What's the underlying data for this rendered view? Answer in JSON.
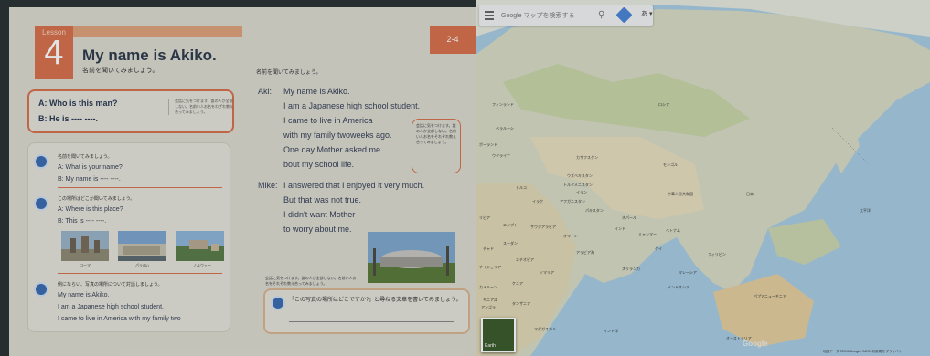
{
  "book": {
    "lesson_label": "Lesson",
    "lesson_number": "4",
    "title": "My name is Akiko.",
    "subtitle": "名前を聞いてみましょう。",
    "page_tab": "2-4",
    "qa": {
      "line1": "A: Who is this man?",
      "line2": "B: He is ---- ----.",
      "note": "会話に気をつけます。誰の人か全部しない。名前い人お名をわざれ教え合ってみましょう。"
    },
    "exercises": [
      {
        "title": "名前を聞いてみましょう。",
        "lines": [
          "A: What is your name?",
          "B: My name is ---- ----."
        ]
      },
      {
        "title": "この場所はどこか聞いてみましょう。",
        "lines": [
          "A: Where is this place?",
          "B: This is ---- ----."
        ],
        "captions": [
          "ローマ",
          "パリ(仏)",
          "ノルウェー"
        ]
      },
      {
        "title": "例にならい、写真の場所について対話しましょう。",
        "lines": [
          "My name is Akiko.",
          "I am a Japanese high school student.",
          "I came to live in America with my family two"
        ]
      }
    ],
    "page2_heading": "名前を聞いてみましょう。",
    "dialogue": [
      {
        "speaker": "Aki:",
        "lines": [
          "My name is Akiko.",
          "I am a Japanese high school student.",
          "I came to live in America",
          "with my family twoweeks ago.",
          "One day Mother asked me",
          "bout my school life."
        ]
      },
      {
        "speaker": "Mike:",
        "lines": [
          "I answered that I enjoyed it very much.",
          "But that was not true.",
          "I didn't want Mother",
          "to worry about me."
        ]
      }
    ],
    "side_note": "会話に気をつけます。誰の人か全部しない。名前い人お名をそれぞれ教え合ってみましょう。",
    "bottom_note": "会話に気をつけます。誰の人か全部しない。名前い人お名をそれぞれ教え合ってみましょう。",
    "write_prompt": "「この写真の場所はどこですか?」と尋ねる文章を書いてみましょう。"
  },
  "map": {
    "search_placeholder": "Google マップを検索する",
    "lang": "あ ▾",
    "earth_label": "Earth",
    "logo": "Google",
    "attribution": "地図データ ©2016 Google, INEGI   利用規約   プライバシー",
    "labels": [
      "ロシア",
      "フィンランド",
      "ポーランド",
      "ウクライナ",
      "カザフスタン",
      "モンゴル",
      "トルコ",
      "イラン",
      "中華人民共和国",
      "日本",
      "インド",
      "エジプト",
      "リビア",
      "サウジアラビア",
      "スーダン",
      "エチオピア",
      "ケニア",
      "タンザニア",
      "アンゴラ",
      "マダガスカル",
      "インドネシア",
      "パプアニューギニア",
      "オーストラリア",
      "フィリピン",
      "タイ",
      "ミャンマー",
      "アフガニスタン",
      "パキスタン",
      "イラク",
      "ソマリア",
      "マレーシア",
      "南アフリカ",
      "ウズベキスタン",
      "ベラルーシ",
      "ナイジェリア",
      "チャド",
      "オマーン",
      "トルクメニスタン",
      "ベトナム",
      "ネパール",
      "カメルーン",
      "アラビア海",
      "インド洋",
      "ギニア湾",
      "太平洋",
      "スリランカ"
    ]
  }
}
